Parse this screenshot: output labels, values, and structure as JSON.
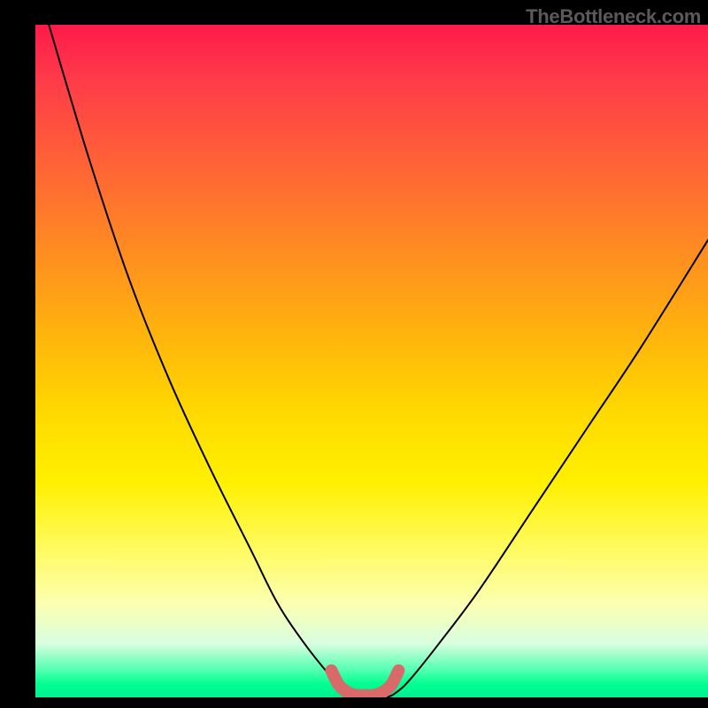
{
  "watermark": "TheBottleneck.com",
  "chart_data": {
    "type": "line",
    "title": "",
    "xlabel": "",
    "ylabel": "",
    "xlim": [
      0,
      100
    ],
    "ylim": [
      0,
      100
    ],
    "series": [
      {
        "name": "bottleneck-curve",
        "x": [
          2,
          8,
          14,
          20,
          26,
          32,
          36,
          40,
          44,
          46,
          48,
          52,
          54,
          56,
          60,
          66,
          74,
          82,
          90,
          100
        ],
        "y": [
          100,
          80,
          62,
          47,
          34,
          22,
          14,
          8,
          3,
          1,
          0,
          0,
          1,
          3,
          8,
          16,
          28,
          40,
          52,
          68
        ]
      },
      {
        "name": "optimal-marker",
        "x": [
          44,
          45,
          46,
          47,
          48,
          49,
          50,
          51,
          52,
          53,
          54
        ],
        "y": [
          4,
          2,
          1,
          0.5,
          0.3,
          0.3,
          0.3,
          0.5,
          1,
          2,
          4
        ]
      }
    ],
    "colors": {
      "curve": "#000000",
      "marker": "#d86a6a",
      "gradient_top": "#ff1a4a",
      "gradient_mid": "#fff000",
      "gradient_bottom": "#00f090"
    }
  }
}
